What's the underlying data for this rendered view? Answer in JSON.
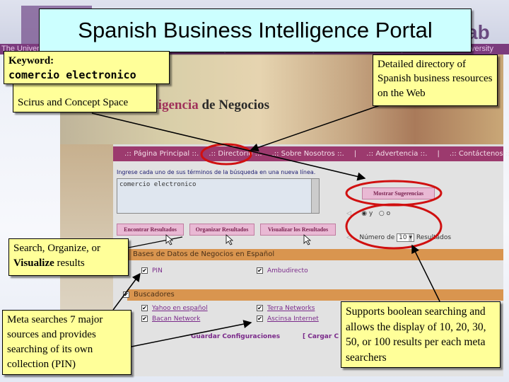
{
  "slide": {
    "title": "Spanish Business Intelligence Portal",
    "logo_fragment": "ab",
    "university_strip": "The University of Arizona   The University of Arizona   The University of Arizona   The University of Arizona   The University of Arizona   The University"
  },
  "callouts": {
    "keyword_label": "Keyword:",
    "keyword_value": "comercio electronico",
    "scirus": "Scirus and Concept Space",
    "directory": "Detailed directory of Spanish business resources on the Web",
    "results": "Search, Organize, or",
    "results_bold": "Visualize",
    "results_tail": " results",
    "meta": "Meta searches 7 major sources and provides searching of its own collection (PIN)",
    "boolean": "Supports boolean searching and allows the display of 10, 20, 30, 50, or 100 results per each meta searchers"
  },
  "site": {
    "title_red": "eligencia",
    "title_rest": " de Negocios",
    "nav": [
      ".:: Página Principal ::.",
      ".:: Directorio ::.",
      ".:: Sobre Nosotros ::.",
      "|",
      ".:: Advertencia ::.",
      "|",
      ".:: Contáctenos ::."
    ],
    "instruction": "Ingrese cada uno de sus términos de la búsqueda en una nueva línea.",
    "query": "comercio electronico",
    "suggest_button": "Mostrar Sugerencias",
    "radio_and": "y",
    "radio_or": "o",
    "radio_selected": "y",
    "num_label": "Número de",
    "num_value": "10",
    "num_suffix": "Resultados",
    "buttons": [
      "Encontrar Resultados",
      "Organizar Resultados",
      "Visualizar los Resultados"
    ],
    "section1": "Bases de Datos de Negocios en Español",
    "section1_items": [
      "PIN",
      "Ambudirecto"
    ],
    "section2": "Buscadores",
    "section2_items": [
      "Yahoo en español",
      "Terra Networks",
      "Bacan Network",
      "Ascinsa Internet"
    ],
    "save_config": "Guardar Configuraciones",
    "load_config": "[ Cargar C"
  },
  "colors": {
    "nav": "#9c3a6e",
    "section": "#d9954f",
    "note": "#ffff99",
    "title_box": "#ccffff",
    "highlight": "#d01010"
  }
}
